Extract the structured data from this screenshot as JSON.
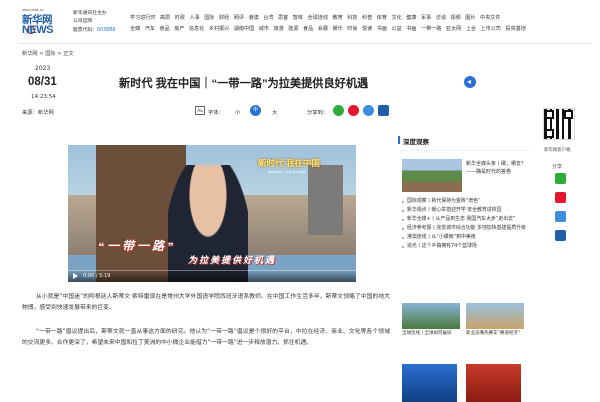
{
  "header": {
    "logo_url": "www.news.cn",
    "logo_cn": "新华网",
    "logo_en": "NEWS",
    "info": [
      "新华通讯社主办",
      "公司官网",
      "股票代码：603888"
    ],
    "stock_code": "603888",
    "nav_row1": [
      "学习进行时",
      "高层",
      "时政",
      "人事",
      "国际",
      "财经",
      "网评",
      "港澳",
      "台湾",
      "思客",
      "智库",
      "全球连线",
      "教育",
      "科技",
      "科普",
      "体育",
      "文化",
      "健康",
      "军事",
      "访谈",
      "视频",
      "图片",
      "中央文件"
    ],
    "nav_row2": [
      "全媒",
      "汽车",
      "食品",
      "房产",
      "信息化",
      "乡村振兴",
      "湖南中国",
      "城市",
      "旅游",
      "能源",
      "食品",
      "会展",
      "娱乐",
      "时尚",
      "悦读",
      "书画",
      "公益",
      "书画",
      "一带一路",
      "亚太网",
      "上合",
      "上市公司",
      "投资基地"
    ]
  },
  "breadcrumb": "新华网 > 国际 > 正文",
  "article": {
    "year": "2023",
    "month_day": "08/31",
    "time": "14:23:54",
    "source": "来源：新华网",
    "title": "新时代 我在中国｜“一带一路”为拉美提供良好机遇",
    "font_label": "字体：",
    "font_small": "小",
    "font_mid": "中",
    "font_large": "大",
    "share_label": "分享到：",
    "paragraphs": [
      "从小就是“中国迷”的阿根廷人斯蒂文·索特雷现在是常州大学外国语学院西班牙语系教师。在中国工作生活多年，斯蒂文领略了中国的地大物博，感受到快速发展带来的巨变。",
      "“一带一路”倡议提出后，斯蒂文就一直从事这方面的研究。他认为“一带一路”倡议是个很好的平台，中拉在经济、商业、文化等各个领域的交流更多、合作更深了，希望未来中国和拉丁美洲的中小微企业能借力“一带一路”进一步释放潜力、抓住机遇。"
    ]
  },
  "video": {
    "caption_top": "新时代 我在中国",
    "caption_sub": "NEW ERA · I AM IN CHINA",
    "banner_main": "“一带一路”",
    "banner_sub": "为拉美提供好机遇",
    "time": "0:00 / 5:19"
  },
  "sidebar": {
    "qr_label": "新华网客户端",
    "share_label": "分享",
    "panel_title": "深度观察",
    "feature_text": "新华全媒头条丨碳，哪去？——确是时代的答卷",
    "list": [
      "国际观察丨新代保持为金砖“增色”",
      "新华视点丨暖心举措迎开学 安全教育进校园",
      "新华全媒+丨从产品到生态 我国汽车大步“走出去”",
      "经济参考报丨完善城市综合功能 多地加快基建提质升级",
      "港澳连线丨从“小爆雨”到中美南",
      "追光丨这个乡镇拥有74个篮球场"
    ],
    "thumb_caps": [
      "全球连线丨全球如何破局",
      "新业态嘴热赛车“赛道经济”"
    ]
  },
  "colors": {
    "brand_blue": "#1f5fa8",
    "accent_blue": "#2a6fd2",
    "red": "#e60012",
    "wechat_green": "#2bad38",
    "weibo_red": "#e6162d"
  }
}
